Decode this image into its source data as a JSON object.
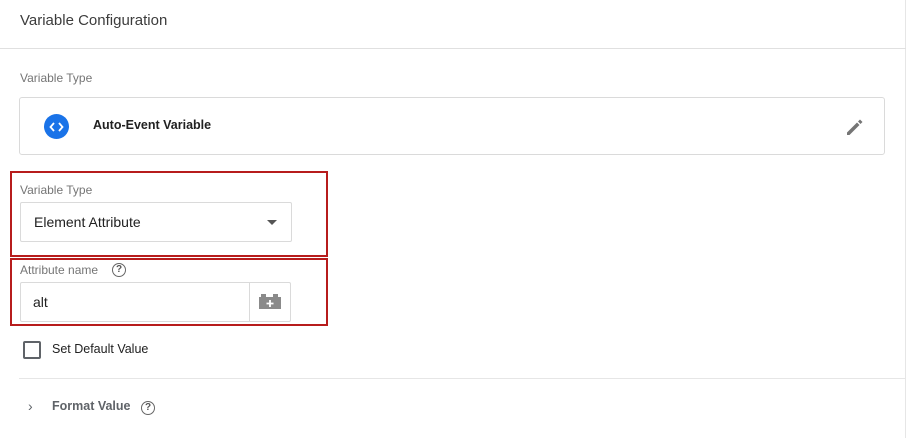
{
  "panel": {
    "title": "Variable Configuration"
  },
  "variable_type_section": {
    "label": "Variable Type",
    "selected_type": "Auto-Event Variable",
    "type_icon": "code-brackets-icon",
    "edit_icon": "pencil-icon"
  },
  "sub_type": {
    "label": "Variable Type",
    "selected_value": "Element Attribute"
  },
  "attribute": {
    "label": "Attribute name",
    "help_glyph": "?",
    "value": "alt",
    "picker_icon": "lego-brick-plus-icon"
  },
  "default_value": {
    "label": "Set Default Value",
    "checked": false
  },
  "format_value": {
    "label": "Format Value",
    "help_glyph": "?",
    "chevron": "›"
  },
  "colors": {
    "accent": "#1a73e8",
    "highlight": "#b71c1c"
  }
}
